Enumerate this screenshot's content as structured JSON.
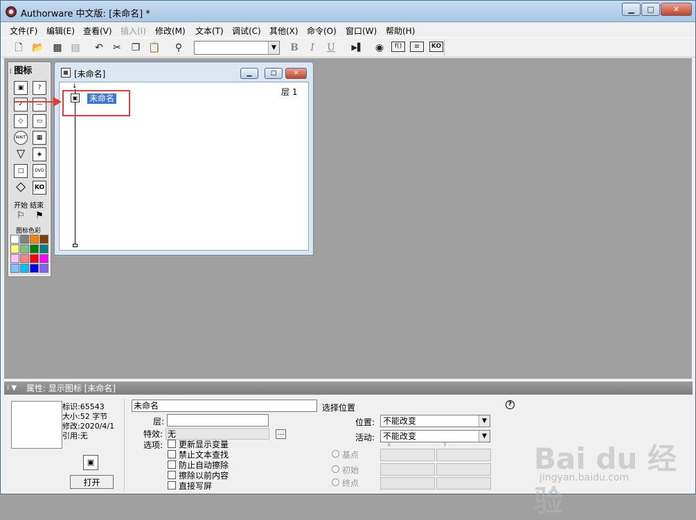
{
  "window": {
    "title": "Authorware 中文版: [未命名] *",
    "min": "▁",
    "max": "□",
    "close": "✕"
  },
  "menu": [
    "文件(F)",
    "编辑(E)",
    "查看(V)",
    "插入(I)",
    "修改(M)",
    "文本(T)",
    "调试(C)",
    "其他(X)",
    "命令(O)",
    "窗口(W)",
    "帮助(H)"
  ],
  "toolbar": {
    "bold": "B",
    "italic": "I",
    "underline": "U",
    "font_value": ""
  },
  "palette": {
    "title": "图标",
    "icons": [
      "▣",
      "?",
      "✓",
      "—",
      "◇",
      "▭",
      "WAIT",
      "▦",
      "▽",
      "◈",
      "□",
      "DVD",
      "◇",
      "KO"
    ],
    "start_end_label": "开始 结束",
    "color_label": "图标色彩",
    "colors": [
      "#ffffff",
      "#808080",
      "#ff8000",
      "#804000",
      "#ffff80",
      "#80c080",
      "#008000",
      "#008080",
      "#ffc0ff",
      "#ff8080",
      "#ff0000",
      "#ff00ff",
      "#80c0ff",
      "#00c0ff",
      "#0000ff",
      "#8060ff"
    ]
  },
  "flow_window": {
    "title": "[未命名]",
    "level": "层 1",
    "item_label": "未命名"
  },
  "properties": {
    "header": "属性: 显示图标 [未命名]",
    "id": "标识:65543",
    "size": "大小:52 字节",
    "modified": "修改:2020/4/1",
    "refs": "引用:无",
    "open_button": "打开",
    "name_value": "未命名",
    "layer_label": "层:",
    "layer_value": "",
    "effect_label": "特效:",
    "effect_value": "无",
    "effect_button": "...",
    "options_label": "选项:",
    "options": [
      "更新显示变量",
      "禁止文本查找",
      "防止自动擦除",
      "擦除以前内容",
      "直接写屏"
    ],
    "select_position_label": "选择位置",
    "position_label": "位置:",
    "position_value": "不能改变",
    "active_label": "活动:",
    "active_value": "不能改变",
    "x_label": "X",
    "y_label": "Y",
    "base_label": "基点",
    "initial_label": "初始",
    "end_label": "终点",
    "help": "?"
  },
  "watermark": {
    "main": "Bai du 经验",
    "sub": "jingyan.baidu.com"
  }
}
